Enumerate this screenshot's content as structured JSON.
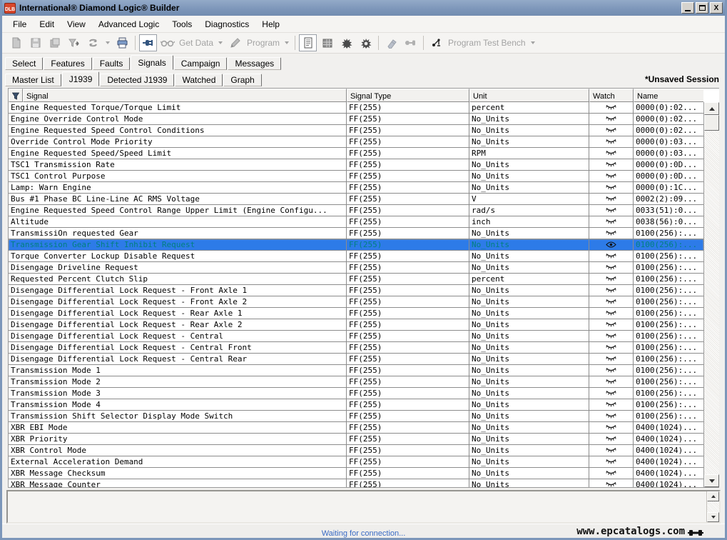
{
  "window": {
    "title": "International® Diamond Logic® Builder",
    "logo_text": "DLB",
    "controls": {
      "minimize": "minimize",
      "maximize": "maximize",
      "close": "X"
    }
  },
  "menu": {
    "items": [
      "File",
      "Edit",
      "View",
      "Advanced Logic",
      "Tools",
      "Diagnostics",
      "Help"
    ]
  },
  "toolbar": {
    "get_data_label": "Get Data",
    "program_label": "Program",
    "program_test_bench_label": "Program Test Bench",
    "icons": [
      "new-document-icon",
      "save-icon",
      "save-all-icon",
      "validate-icon",
      "refresh-icon",
      "print-icon",
      "connect-icon",
      "glasses-icon",
      "pencil-icon",
      "document-icon",
      "grid-icon",
      "bug-icon",
      "bug2-icon",
      "eraser-icon",
      "plug-icon",
      "test-bench-icon"
    ]
  },
  "tabs": {
    "primary": [
      "Select",
      "Features",
      "Faults",
      "Signals",
      "Campaign",
      "Messages"
    ],
    "primary_active": "Signals",
    "secondary": [
      "Master List",
      "J1939",
      "Detected J1939",
      "Watched",
      "Graph"
    ],
    "secondary_active": "J1939",
    "session_label": "*Unsaved Session"
  },
  "table": {
    "columns": [
      "Signal",
      "Signal Type",
      "Unit",
      "Watch",
      "Name"
    ],
    "filter_icon": "funnel-icon",
    "watch_icons": {
      "closed": "eye-closed-icon",
      "open": "eye-open-icon"
    },
    "rows": [
      {
        "signal": "Engine Requested Torque/Torque Limit",
        "type": "FF(255)",
        "unit": "percent",
        "watch": "closed",
        "name": "0000(0):02...",
        "selected": false
      },
      {
        "signal": "Engine Override Control Mode",
        "type": "FF(255)",
        "unit": "No_Units",
        "watch": "closed",
        "name": "0000(0):02...",
        "selected": false
      },
      {
        "signal": "Engine Requested Speed Control Conditions",
        "type": "FF(255)",
        "unit": "No_Units",
        "watch": "closed",
        "name": "0000(0):02...",
        "selected": false
      },
      {
        "signal": "Override Control Mode Priority",
        "type": "FF(255)",
        "unit": "No_Units",
        "watch": "closed",
        "name": "0000(0):03...",
        "selected": false
      },
      {
        "signal": "Engine Requested Speed/Speed Limit",
        "type": "FF(255)",
        "unit": "RPM",
        "watch": "closed",
        "name": "0000(0):03...",
        "selected": false
      },
      {
        "signal": "TSC1 Transmission Rate",
        "type": "FF(255)",
        "unit": "No_Units",
        "watch": "closed",
        "name": "0000(0):0D...",
        "selected": false
      },
      {
        "signal": "TSC1 Control Purpose",
        "type": "FF(255)",
        "unit": "No_Units",
        "watch": "closed",
        "name": "0000(0):0D...",
        "selected": false
      },
      {
        "signal": "Lamp: Warn Engine",
        "type": "FF(255)",
        "unit": "No_Units",
        "watch": "closed",
        "name": "0000(0):1C...",
        "selected": false
      },
      {
        "signal": "Bus #1 Phase BC Line-Line AC RMS Voltage",
        "type": "FF(255)",
        "unit": "V",
        "watch": "closed",
        "name": "0002(2):09...",
        "selected": false
      },
      {
        "signal": "Engine Requested Speed Control Range Upper Limit (Engine Configu...",
        "type": "FF(255)",
        "unit": "rad/s",
        "watch": "closed",
        "name": "0033(51):0...",
        "selected": false
      },
      {
        "signal": "Altitude",
        "type": "FF(255)",
        "unit": "inch",
        "watch": "closed",
        "name": "0038(56):0...",
        "selected": false
      },
      {
        "signal": "TransmissiOn requested Gear",
        "type": "FF(255)",
        "unit": "No_Units",
        "watch": "closed",
        "name": "0100(256):...",
        "selected": false
      },
      {
        "signal": "Transmission Gear Shift Inhibit Request",
        "type": "FF(255)",
        "unit": "No_Units",
        "watch": "open",
        "name": "0100(256):...",
        "selected": true
      },
      {
        "signal": "Torque Converter Lockup Disable Request",
        "type": "FF(255)",
        "unit": "No_Units",
        "watch": "closed",
        "name": "0100(256):...",
        "selected": false
      },
      {
        "signal": "Disengage Driveline Request",
        "type": "FF(255)",
        "unit": "No_Units",
        "watch": "closed",
        "name": "0100(256):...",
        "selected": false
      },
      {
        "signal": "Requested Percent Clutch Slip",
        "type": "FF(255)",
        "unit": "percent",
        "watch": "closed",
        "name": "0100(256):...",
        "selected": false
      },
      {
        "signal": "Disengage Differential Lock Request - Front Axle 1",
        "type": "FF(255)",
        "unit": "No_Units",
        "watch": "closed",
        "name": "0100(256):...",
        "selected": false
      },
      {
        "signal": "Disengage Differential Lock Request - Front Axle 2",
        "type": "FF(255)",
        "unit": "No_Units",
        "watch": "closed",
        "name": "0100(256):...",
        "selected": false
      },
      {
        "signal": "Disengage Differential Lock Request - Rear Axle 1",
        "type": "FF(255)",
        "unit": "No_Units",
        "watch": "closed",
        "name": "0100(256):...",
        "selected": false
      },
      {
        "signal": "Disengage Differential Lock Request - Rear Axle 2",
        "type": "FF(255)",
        "unit": "No_Units",
        "watch": "closed",
        "name": "0100(256):...",
        "selected": false
      },
      {
        "signal": "Disengage Differential Lock Request - Central",
        "type": "FF(255)",
        "unit": "No_Units",
        "watch": "closed",
        "name": "0100(256):...",
        "selected": false
      },
      {
        "signal": "Disengage Differential Lock Request - Central Front",
        "type": "FF(255)",
        "unit": "No_Units",
        "watch": "closed",
        "name": "0100(256):...",
        "selected": false
      },
      {
        "signal": "Disengage Differential Lock Request - Central Rear",
        "type": "FF(255)",
        "unit": "No_Units",
        "watch": "closed",
        "name": "0100(256):...",
        "selected": false
      },
      {
        "signal": "Transmission Mode 1",
        "type": "FF(255)",
        "unit": "No_Units",
        "watch": "closed",
        "name": "0100(256):...",
        "selected": false
      },
      {
        "signal": "Transmission Mode 2",
        "type": "FF(255)",
        "unit": "No_Units",
        "watch": "closed",
        "name": "0100(256):...",
        "selected": false
      },
      {
        "signal": "Transmission Mode 3",
        "type": "FF(255)",
        "unit": "No_Units",
        "watch": "closed",
        "name": "0100(256):...",
        "selected": false
      },
      {
        "signal": "Transmission Mode 4",
        "type": "FF(255)",
        "unit": "No_Units",
        "watch": "closed",
        "name": "0100(256):...",
        "selected": false
      },
      {
        "signal": "Transmission Shift Selector Display Mode Switch",
        "type": "FF(255)",
        "unit": "No_Units",
        "watch": "closed",
        "name": "0100(256):...",
        "selected": false
      },
      {
        "signal": "XBR EBI Mode",
        "type": "FF(255)",
        "unit": "No_Units",
        "watch": "closed",
        "name": "0400(1024)...",
        "selected": false
      },
      {
        "signal": "XBR Priority",
        "type": "FF(255)",
        "unit": "No_Units",
        "watch": "closed",
        "name": "0400(1024)...",
        "selected": false
      },
      {
        "signal": "XBR Control Mode",
        "type": "FF(255)",
        "unit": "No_Units",
        "watch": "closed",
        "name": "0400(1024)...",
        "selected": false
      },
      {
        "signal": "External Acceleration Demand",
        "type": "FF(255)",
        "unit": "No_Units",
        "watch": "closed",
        "name": "0400(1024)...",
        "selected": false
      },
      {
        "signal": "XBR Message Checksum",
        "type": "FF(255)",
        "unit": "No_Units",
        "watch": "closed",
        "name": "0400(1024)...",
        "selected": false
      },
      {
        "signal": "XBR Message Counter",
        "type": "FF(255)",
        "unit": "No Units",
        "watch": "closed",
        "name": "0400(1024)...",
        "selected": false
      }
    ]
  },
  "status": {
    "message": "Waiting for connection...",
    "watermark": "www.epcatalogs.com"
  },
  "colors": {
    "selection_bg": "#2d7be8",
    "selection_text": "#008080",
    "titlebar": "#7c96ba",
    "status_text": "#3a6bc4",
    "logo_red": "#d9472b"
  }
}
